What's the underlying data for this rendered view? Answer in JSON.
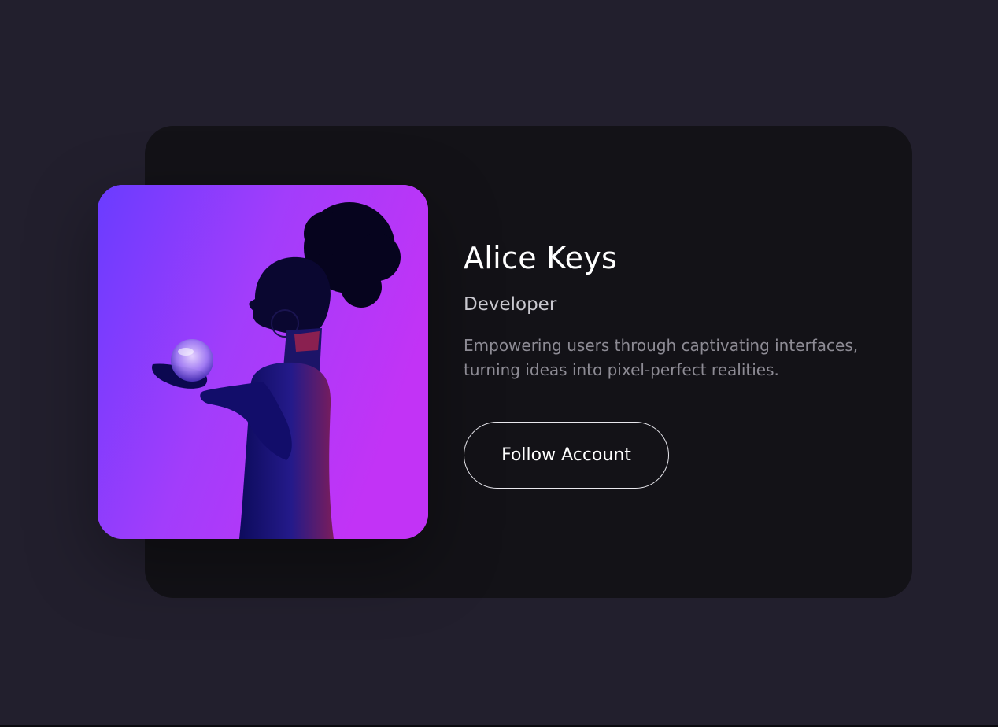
{
  "profile": {
    "name": "Alice Keys",
    "role": "Developer",
    "bio": "Empowering users through captivating interfaces, turning ideas into pixel-perfect realities.",
    "follow_label": "Follow Account"
  },
  "theme": {
    "background": "#221f2d",
    "card": "#131217",
    "photo_gradient_start": "#6a3cff",
    "photo_gradient_end": "#c233f6"
  }
}
